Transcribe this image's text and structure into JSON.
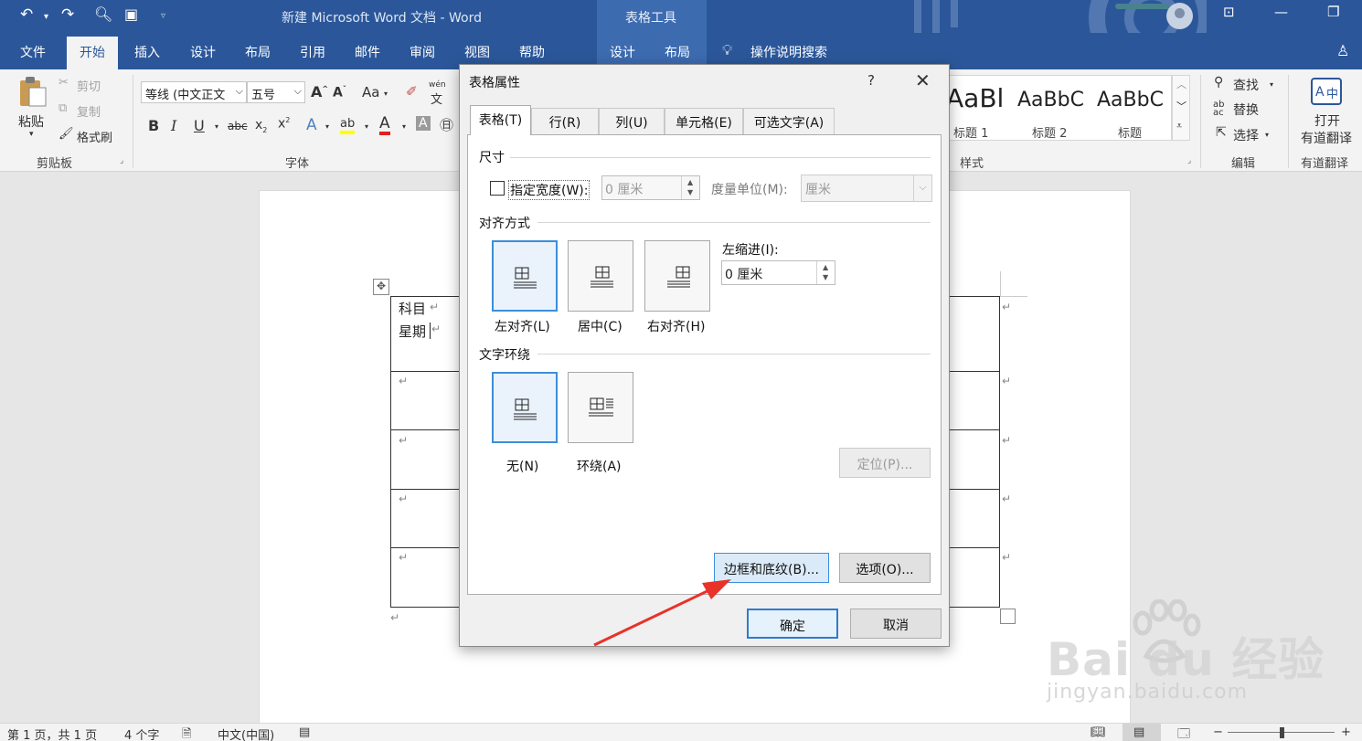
{
  "window": {
    "doc_title": "新建 Microsoft Word 文档 - Word",
    "context_title": "表格工具"
  },
  "ribbon_tabs": {
    "file": "文件",
    "home": "开始",
    "insert": "插入",
    "design": "设计",
    "layout": "布局",
    "references": "引用",
    "mailings": "邮件",
    "review": "审阅",
    "view": "视图",
    "help": "帮助",
    "table_design": "设计",
    "table_layout": "布局",
    "tell_me": "操作说明搜索"
  },
  "clipboard": {
    "paste": "粘贴",
    "cut": "剪切",
    "copy": "复制",
    "format_painter": "格式刷",
    "group": "剪贴板"
  },
  "font": {
    "family": "等线 (中文正文",
    "size": "五号",
    "case": "Aa",
    "phonetic": "wén",
    "group": "字体"
  },
  "styles": {
    "items": [
      {
        "sample": "AaBl",
        "name": ""
      },
      {
        "sample": "AaBbC",
        "name": "标题 1"
      },
      {
        "sample": "AaBbC",
        "name": "标题 2"
      },
      {
        "sample": "AaBbC",
        "name": "标题"
      }
    ],
    "heading1_label": "标题 1",
    "group": "样式"
  },
  "editing": {
    "find": "查找",
    "replace": "替换",
    "select": "选择",
    "group": "编辑"
  },
  "youdao": {
    "open": "打开",
    "translate": "有道翻译",
    "group": "有道翻译"
  },
  "document": {
    "cell_line1": "科目",
    "cell_line2": "星期"
  },
  "statusbar": {
    "page": "第 1 页，共 1 页",
    "words": "4 个字",
    "language": "中文(中国)"
  },
  "watermark": {
    "brand": "Bai du 经验",
    "url": "jingyan.baidu.com"
  },
  "dialog": {
    "title": "表格属性",
    "help": "?",
    "tabs": [
      "表格(T)",
      "行(R)",
      "列(U)",
      "单元格(E)",
      "可选文字(A)"
    ],
    "size_section": "尺寸",
    "specify_width": "指定宽度(W):",
    "width_value": "0 厘米",
    "measure_label": "度量单位(M):",
    "measure_value": "厘米",
    "align_section": "对齐方式",
    "align_options": [
      "左对齐(L)",
      "居中(C)",
      "右对齐(H)"
    ],
    "indent_label": "左缩进(I):",
    "indent_value": "0 厘米",
    "wrap_section": "文字环绕",
    "wrap_options": [
      "无(N)",
      "环绕(A)"
    ],
    "position_button": "定位(P)...",
    "borders_button": "边框和底纹(B)...",
    "options_button": "选项(O)...",
    "ok": "确定",
    "cancel": "取消"
  }
}
